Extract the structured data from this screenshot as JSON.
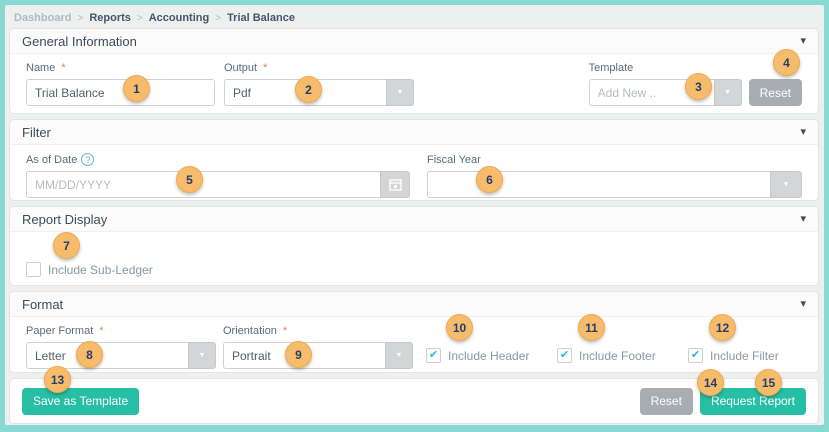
{
  "breadcrumb": {
    "items": [
      "Dashboard",
      "Reports",
      "Accounting",
      "Trial Balance"
    ],
    "separator": ">"
  },
  "glyphs": {
    "required": "*",
    "check": "✔",
    "chevron_down": "▾",
    "dropdown_arrow": "▼",
    "help": "?"
  },
  "general": {
    "title": "General Information",
    "name": {
      "label": "Name",
      "value": "Trial Balance"
    },
    "output": {
      "label": "Output",
      "value": "Pdf"
    },
    "template": {
      "label": "Template",
      "placeholder": "Add New .."
    },
    "reset_label": "Reset"
  },
  "filter": {
    "title": "Filter",
    "as_of_date": {
      "label": "As of Date",
      "placeholder": "MM/DD/YYYY"
    },
    "fiscal_year": {
      "label": "Fiscal Year",
      "value": ""
    }
  },
  "report_display": {
    "title": "Report Display",
    "include_sub_ledger": {
      "label": "Include Sub-Ledger",
      "checked": false
    }
  },
  "format": {
    "title": "Format",
    "paper_format": {
      "label": "Paper Format",
      "value": "Letter"
    },
    "orientation": {
      "label": "Orientation",
      "value": "Portrait"
    },
    "options": [
      {
        "label": "Include Header",
        "checked": true
      },
      {
        "label": "Include Footer",
        "checked": true
      },
      {
        "label": "Include Filter",
        "checked": true
      }
    ]
  },
  "footer": {
    "save_as_template": "Save as Template",
    "reset": "Reset",
    "request_report": "Request Report"
  },
  "markers": [
    "1",
    "2",
    "3",
    "4",
    "5",
    "6",
    "7",
    "8",
    "9",
    "10",
    "11",
    "12",
    "13",
    "14",
    "15"
  ],
  "colors": {
    "frame_teal": "#87d9d3",
    "accent_teal": "#26bfa5",
    "reset_gray": "#a7adb2",
    "marker_orange": "#f6bc6c",
    "check_blue": "#29b6e8",
    "required_orange": "#e67e45"
  }
}
